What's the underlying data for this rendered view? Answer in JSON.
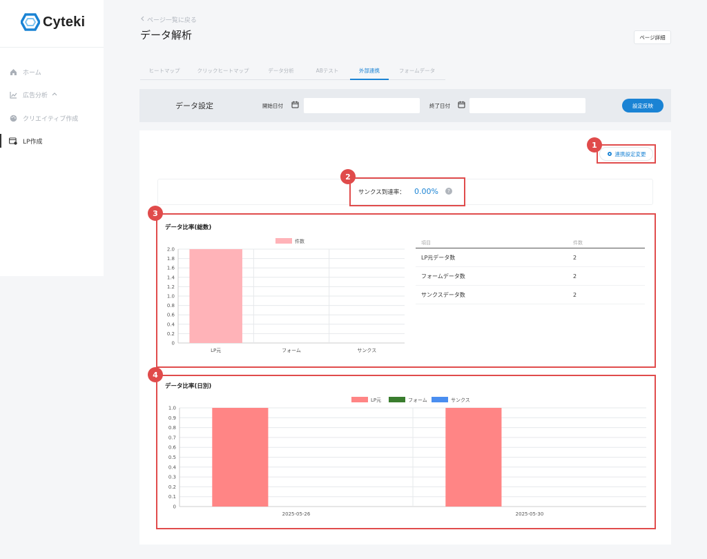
{
  "brand": {
    "name": "Cyteki",
    "color": "#1a83d4"
  },
  "sidebar": {
    "items": [
      {
        "label": "ホーム",
        "icon": "home-icon"
      },
      {
        "label": "広告分析",
        "icon": "chart-line-icon",
        "suffix": "^"
      },
      {
        "label": "クリエイティブ作成",
        "icon": "palette-icon"
      },
      {
        "label": "LP作成",
        "icon": "lp-icon",
        "active": true
      }
    ]
  },
  "header": {
    "back_label": "ページ一覧に戻る",
    "title": "データ解析",
    "detail_button": "ページ詳細"
  },
  "tabs": [
    {
      "label": "ヒートマップ"
    },
    {
      "label": "クリックヒートマップ"
    },
    {
      "label": "データ分析"
    },
    {
      "label": "ABテスト"
    },
    {
      "label": "外部連携",
      "active": true
    },
    {
      "label": "フォームデータ"
    }
  ],
  "settings": {
    "title": "データ設定",
    "start_label": "開始日付",
    "end_label": "終了日付",
    "start_value": "",
    "end_value": "",
    "apply_button": "設定反映"
  },
  "link_settings_button": "連携設定変更",
  "thanks_rate": {
    "label": "サンクス到達率：",
    "value": "0.00%"
  },
  "annotations": [
    "1",
    "2",
    "3",
    "4"
  ],
  "total_section": {
    "title": "データ比率(総数)",
    "table": {
      "headers": [
        "項目",
        "件数"
      ],
      "rows": [
        {
          "item": "LP元データ数",
          "count": "2"
        },
        {
          "item": "フォームデータ数",
          "count": "2"
        },
        {
          "item": "サンクスデータ数",
          "count": "2"
        }
      ]
    }
  },
  "daily_section": {
    "title": "データ比率(日別)"
  },
  "chart_data": [
    {
      "type": "bar",
      "categories": [
        "LP元",
        "フォーム",
        "サンクス"
      ],
      "series": [
        {
          "name": "件数",
          "values": [
            2,
            0,
            0
          ],
          "color": "#ffb3b8"
        }
      ],
      "ylim": [
        0,
        2.0
      ],
      "yticks": [
        "2.0",
        "1.8",
        "1.6",
        "1.4",
        "1.2",
        "1.0",
        "0.8",
        "0.6",
        "0.4",
        "0.2",
        "0"
      ],
      "legend": "top-center",
      "grid": true
    },
    {
      "type": "bar",
      "categories": [
        "2025-05-26",
        "2025-05-30"
      ],
      "series": [
        {
          "name": "LP元",
          "values": [
            1,
            1
          ],
          "color": "#ff8585"
        },
        {
          "name": "フォーム",
          "values": [
            0,
            0
          ],
          "color": "#3a7d2e"
        },
        {
          "name": "サンクス",
          "values": [
            0,
            0
          ],
          "color": "#4a8ef0"
        }
      ],
      "ylim": [
        0,
        1.0
      ],
      "yticks": [
        "1.0",
        "0.9",
        "0.8",
        "0.7",
        "0.6",
        "0.5",
        "0.4",
        "0.3",
        "0.2",
        "0.1",
        "0"
      ],
      "legend": "top-center",
      "grid": true
    }
  ]
}
